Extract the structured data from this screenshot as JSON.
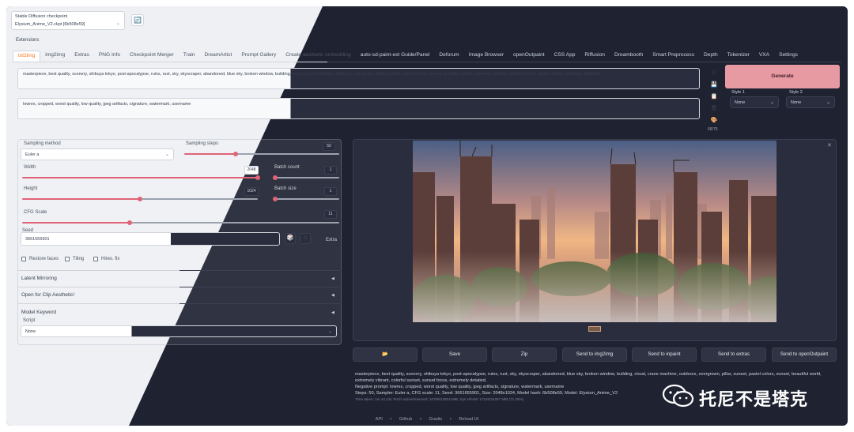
{
  "checkpoint": {
    "title": "Stable Diffusion checkpoint",
    "value": "Elysium_Anime_V2.ckpt [6b508e59]"
  },
  "extensions_label": "Extensions",
  "tabs": [
    "txt2img",
    "img2img",
    "Extras",
    "PNG Info",
    "Checkpoint Merger",
    "Train",
    "DreamArtist",
    "Prompt Gallery",
    "Create aesthetic embedding",
    "auto-sd-paint-ext Guide/Panel",
    "Deforum",
    "Image Browser",
    "openOutpaint",
    "CSS App",
    "Riffusion",
    "Dreambooth",
    "Smart Preprocess",
    "Depth",
    "Tokenizer",
    "VXA",
    "Settings"
  ],
  "prompt": "masterpiece, best quality, scenery, shibuya tokyo, post-apocalypse, ruins, rust, sky, skyscraper, abandoned, blue sky, broken window, building, cloud, crane machine, outdoors, overgrown, pillar, sunset, pastel colors, sunset, beautiful world, extremely vibrant, colorful sunset, sunset focus, extremely detailed,",
  "negative_prompt": "lowres, cropped, worst quality, low quality, jpeg artifacts, signature, watermark, username",
  "token_count": "68/75",
  "generate_label": "Generate",
  "style1": {
    "label": "Style 1",
    "value": "None"
  },
  "style2": {
    "label": "Style 2",
    "value": "None"
  },
  "sampling_method": {
    "label": "Sampling method",
    "value": "Euler a"
  },
  "sampling_steps": {
    "label": "Sampling steps",
    "value": "50",
    "fraction": 0.33
  },
  "width": {
    "label": "Width",
    "value": "2048",
    "fraction": 1.0
  },
  "height": {
    "label": "Height",
    "value": "1024",
    "fraction": 0.5
  },
  "batch_count": {
    "label": "Batch count",
    "value": "1",
    "fraction": 0.0
  },
  "batch_size": {
    "label": "Batch size",
    "value": "1",
    "fraction": 0.0
  },
  "cfg_scale": {
    "label": "CFG Scale",
    "value": "11",
    "fraction": 0.34
  },
  "seed": {
    "label": "Seed",
    "value": "3661655901"
  },
  "extra_label": "Extra",
  "checkboxes": {
    "restore_faces": "Restore faces",
    "tiling": "Tiling",
    "hires_fix": "Hires. fix"
  },
  "accordions": {
    "latent_mirroring": "Latent Mirroring",
    "clip_aesthetic": "Open for Clip Aesthetic!",
    "model_keyword": "Model Keyword"
  },
  "script": {
    "label": "Script",
    "value": "None"
  },
  "actions": [
    "📂",
    "Save",
    "Zip",
    "Send to img2img",
    "Send to inpaint",
    "Send to extras",
    "Send to openOutpaint"
  ],
  "generation_info": {
    "prompt_line": "masterpiece, best quality, scenery, shibuya tokyo, post-apocalypse, ruins, rust, sky, skyscraper, abandoned, blue sky, broken window, building, cloud, crane machine, outdoors, overgrown, pillar, sunset, pastel colors, sunset, beautiful world, extremely vibrant, colorful sunset, sunset focus, extremely detailed,",
    "negative_line": "Negative prompt: lowres, cropped, worst quality, low quality, jpeg artifacts, signature, watermark, username",
    "params_line": "Steps: 50, Sampler: Euler a, CFG scale: 11, Seed: 3661655901, Size: 2048x1024, Model hash: 6b508e59, Model: Elysium_Anime_V2",
    "timing_line": "Time taken: 1m 44.12s  Torch active/reserved: 10799/13924 MiB, Sys VRAM: 17192/24257 MiB (71.28%)"
  },
  "footer": [
    "API",
    "•",
    "Github",
    "•",
    "Gradio",
    "•",
    "Reload UI"
  ],
  "watermark_text": "托尼不是塔克",
  "colors": {
    "accent": "#f97316",
    "generate": "#e89aa3",
    "slider": "#e06377",
    "dark_bg": "#1f2231",
    "light_bg": "#eef0f4"
  }
}
